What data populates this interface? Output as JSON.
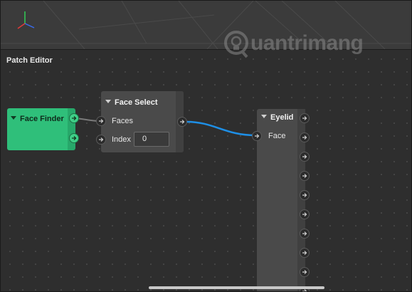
{
  "editor": {
    "title": "Patch Editor"
  },
  "watermark": {
    "text": "uantrimang"
  },
  "patches": {
    "face_finder": {
      "title": "Face Finder"
    },
    "face_select": {
      "title": "Face Select",
      "inputs": [
        "Faces",
        "Index"
      ],
      "index_value": "0"
    },
    "eyelid": {
      "title": "Eyelid",
      "inputs": [
        "Face"
      ]
    }
  },
  "colors": {
    "face_finder": "#2fbf7a",
    "connection_active": "#1e8fe6",
    "connection_inactive": "#7a7a7a"
  },
  "icons": {
    "port": "arrow-right-icon",
    "collapse": "triangle-down-icon"
  }
}
